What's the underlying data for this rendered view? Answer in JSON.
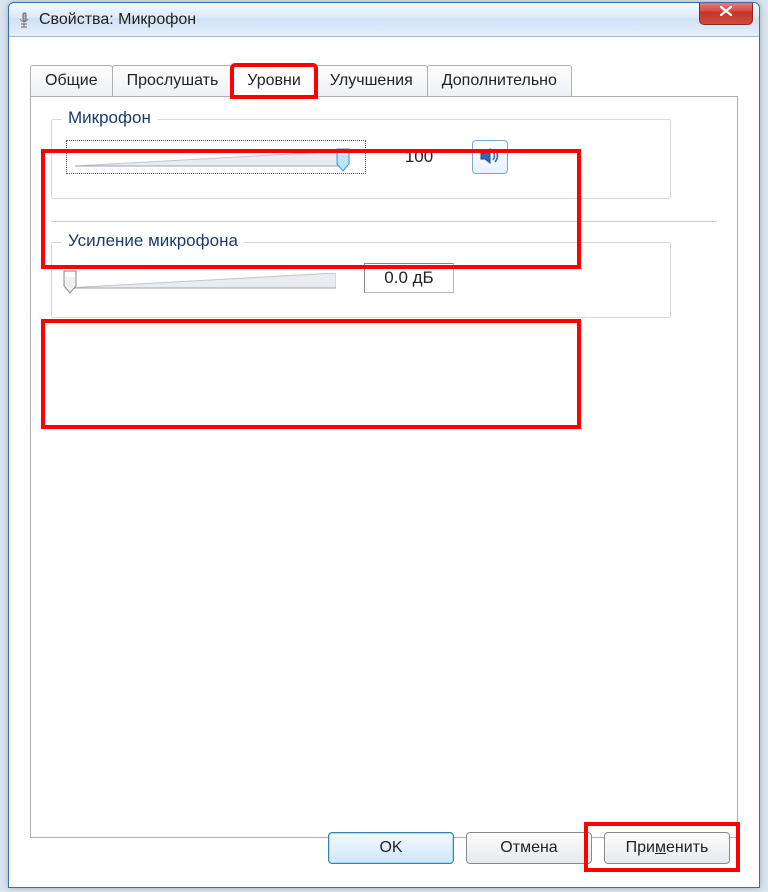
{
  "window": {
    "title": "Свойства: Микрофон"
  },
  "tabs": {
    "general": "Общие",
    "listen": "Прослушать",
    "levels": "Уровни",
    "enhance": "Улучшения",
    "advanced": "Дополнительно"
  },
  "mic": {
    "legend": "Микрофон",
    "value": "100"
  },
  "gain": {
    "legend": "Усиление микрофона",
    "value": "0.0 дБ"
  },
  "buttons": {
    "ok": "OK",
    "cancel": "Отмена",
    "apply_pre": "При",
    "apply_u": "м",
    "apply_post": "енить"
  }
}
